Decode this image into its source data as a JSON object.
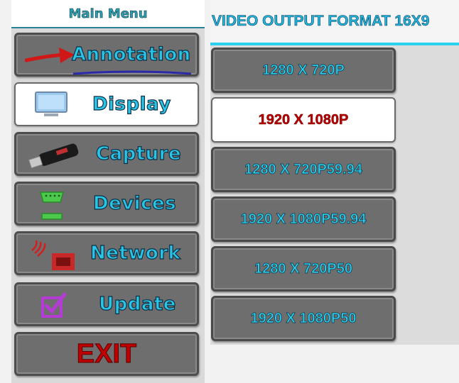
{
  "menu": {
    "title": "Main Menu",
    "items": [
      {
        "label": "Annotation",
        "icon": "arrow-icon",
        "active": false
      },
      {
        "label": "Display",
        "icon": "monitor-icon",
        "active": true
      },
      {
        "label": "Capture",
        "icon": "usb-drive-icon",
        "active": false
      },
      {
        "label": "Devices",
        "icon": "serial-port-icon",
        "active": false
      },
      {
        "label": "Network",
        "icon": "wireless-network-icon",
        "active": false
      },
      {
        "label": "Update",
        "icon": "checkbox-icon",
        "active": false
      }
    ],
    "exit_label": "EXIT"
  },
  "output": {
    "title": "VIDEO OUTPUT FORMAT 16X9",
    "formats": [
      {
        "label": "1280 X 720P",
        "selected": false
      },
      {
        "label": "1920 X 1080P",
        "selected": true
      },
      {
        "label": "1280 X 720P59.94",
        "selected": false
      },
      {
        "label": "1920 X 1080P59.94",
        "selected": false
      },
      {
        "label": "1280 X 720P50",
        "selected": false
      },
      {
        "label": "1920 X 1080P50",
        "selected": false
      }
    ]
  },
  "colors": {
    "accent": "#2ad0ee",
    "selected_text": "#c00000",
    "button_bg": "#6e6e6e"
  }
}
